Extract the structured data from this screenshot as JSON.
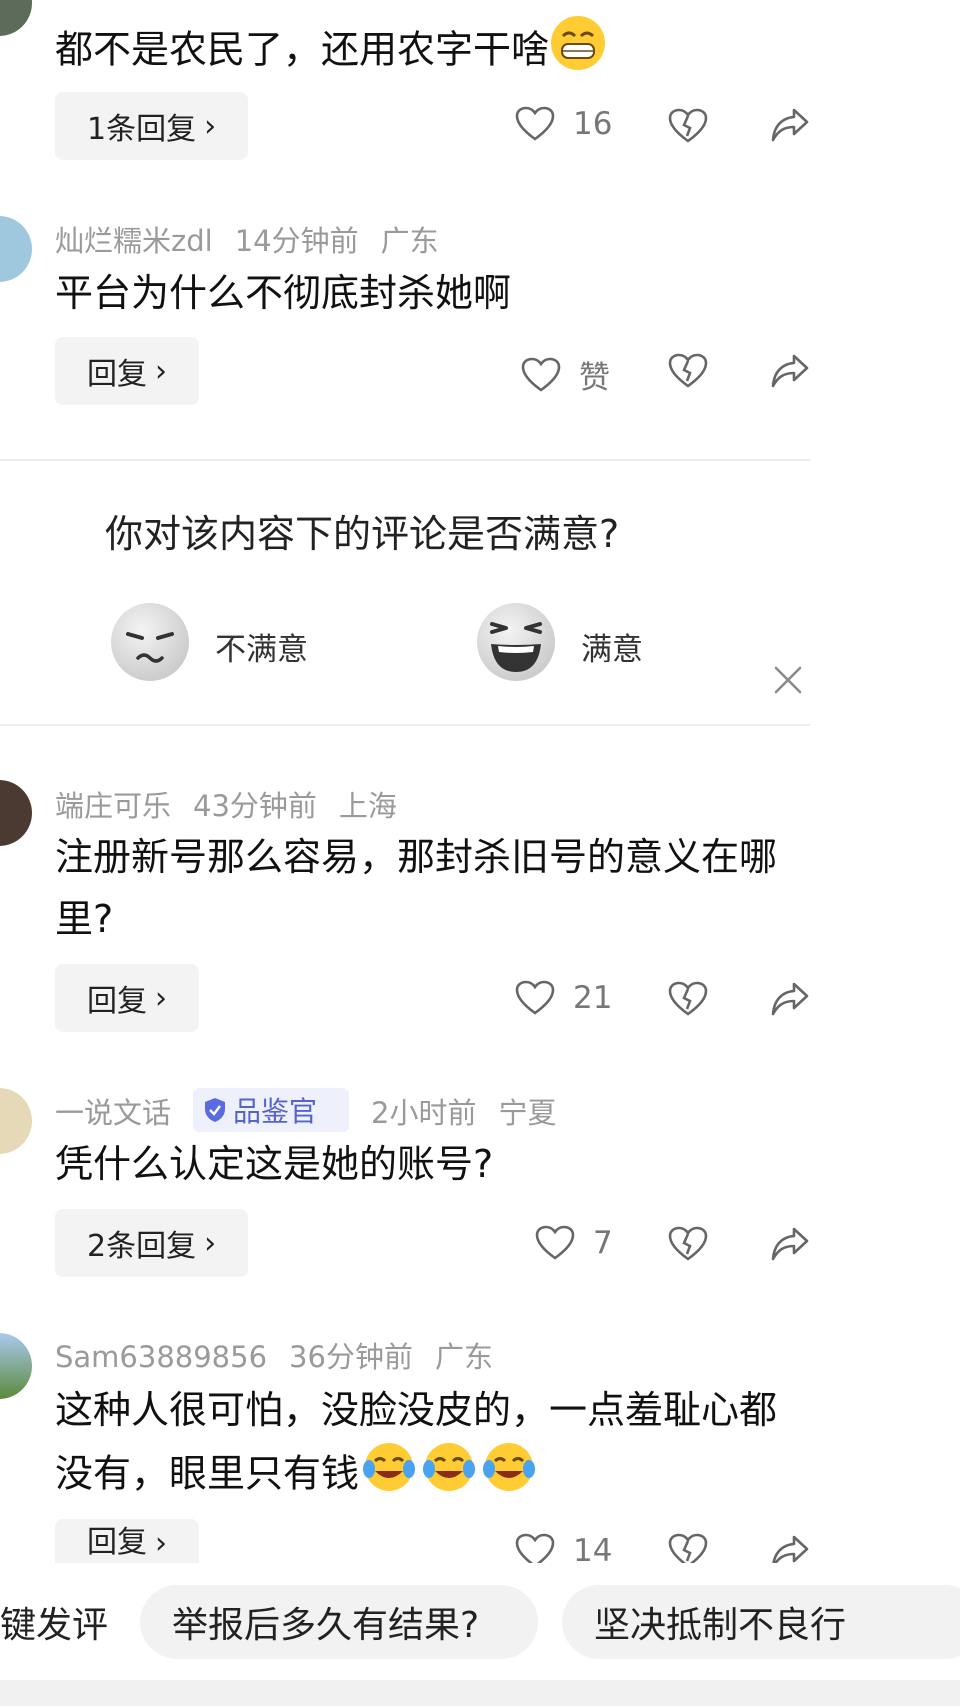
{
  "comments": [
    {
      "text": "都不是农民了，还用农字干啥",
      "reply_label": "1条回复",
      "likes": "16"
    },
    {
      "user": "灿烂糯米zdl",
      "time": "14分钟前",
      "location": "广东",
      "text": "平台为什么不彻底封杀她啊",
      "reply_label": "回复",
      "likes": "赞"
    },
    {
      "user": "端庄可乐",
      "time": "43分钟前",
      "location": "上海",
      "text": "注册新号那么容易，那封杀旧号的意义在哪里?",
      "reply_label": "回复",
      "likes": "21"
    },
    {
      "user": "一说文话",
      "badge": "品鉴官",
      "time": "2小时前",
      "location": "宁夏",
      "text": "凭什么认定这是她的账号?",
      "reply_label": "2条回复",
      "likes": "7"
    },
    {
      "user": "Sam63889856",
      "time": "36分钟前",
      "location": "广东",
      "text": "这种人很可怕，没脸没皮的，一点羞耻心都没有，眼里只有钱",
      "reply_label": "回复",
      "likes": "14"
    }
  ],
  "survey": {
    "question": "你对该内容下的评论是否满意?",
    "option_bad": "不满意",
    "option_good": "满意"
  },
  "chips": {
    "chip1": "键发评",
    "chip2": "举报后多久有结果?",
    "chip3": "坚决抵制不良行"
  },
  "icons": {
    "like": "heart-icon",
    "dislike": "broken-heart-icon",
    "share": "share-arrow-icon",
    "close": "close-icon"
  }
}
